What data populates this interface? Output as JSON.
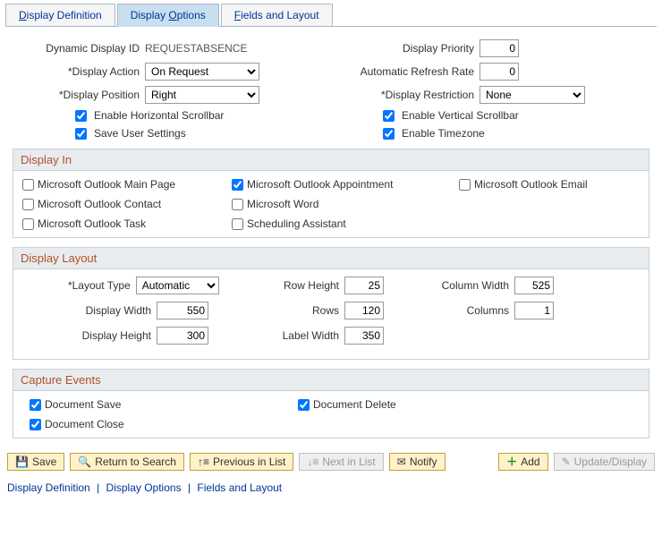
{
  "tabs": [
    "Display Definition",
    "Display Options",
    "Fields and Layout"
  ],
  "active_tab": 1,
  "form": {
    "dynamic_display_id_label": "Dynamic Display ID",
    "dynamic_display_id": "REQUESTABSENCE",
    "display_priority_label": "Display Priority",
    "display_priority": "0",
    "display_action_label": "*Display Action",
    "display_action": "On Request",
    "automatic_refresh_rate_label": "Automatic Refresh Rate",
    "automatic_refresh_rate": "0",
    "display_position_label": "*Display Position",
    "display_position": "Right",
    "display_restriction_label": "*Display Restriction",
    "display_restriction": "None",
    "enable_horizontal_scrollbar_label": "Enable Horizontal Scrollbar",
    "enable_horizontal_scrollbar": true,
    "enable_vertical_scrollbar_label": "Enable Vertical Scrollbar",
    "enable_vertical_scrollbar": true,
    "save_user_settings_label": "Save User Settings",
    "save_user_settings": true,
    "enable_timezone_label": "Enable Timezone",
    "enable_timezone": true
  },
  "display_in": {
    "title": "Display In",
    "items": [
      {
        "label": "Microsoft Outlook Main Page",
        "checked": false
      },
      {
        "label": "Microsoft Outlook Appointment",
        "checked": true
      },
      {
        "label": "Microsoft Outlook Email",
        "checked": false
      },
      {
        "label": "Microsoft Outlook Contact",
        "checked": false
      },
      {
        "label": "Microsoft Word",
        "checked": false
      },
      {
        "label": "",
        "checked": null
      },
      {
        "label": "Microsoft Outlook Task",
        "checked": false
      },
      {
        "label": "Scheduling Assistant",
        "checked": false
      },
      {
        "label": "",
        "checked": null
      }
    ]
  },
  "layout": {
    "title": "Display Layout",
    "layout_type_label": "*Layout Type",
    "layout_type": "Automatic",
    "row_height_label": "Row Height",
    "row_height": "25",
    "column_width_label": "Column Width",
    "column_width": "525",
    "display_width_label": "Display Width",
    "display_width": "550",
    "rows_label": "Rows",
    "rows": "120",
    "columns_label": "Columns",
    "columns": "1",
    "display_height_label": "Display Height",
    "display_height": "300",
    "label_width_label": "Label Width",
    "label_width": "350"
  },
  "events": {
    "title": "Capture Events",
    "doc_save_label": "Document Save",
    "doc_save": true,
    "doc_delete_label": "Document Delete",
    "doc_delete": true,
    "doc_close_label": "Document Close",
    "doc_close": true
  },
  "buttons": {
    "save": "Save",
    "return_to_search": "Return to Search",
    "previous_in_list": "Previous in List",
    "next_in_list": "Next in List",
    "notify": "Notify",
    "add": "Add",
    "update_display": "Update/Display"
  },
  "footer": {
    "links": [
      "Display Definition",
      "Display Options",
      "Fields and Layout"
    ]
  }
}
